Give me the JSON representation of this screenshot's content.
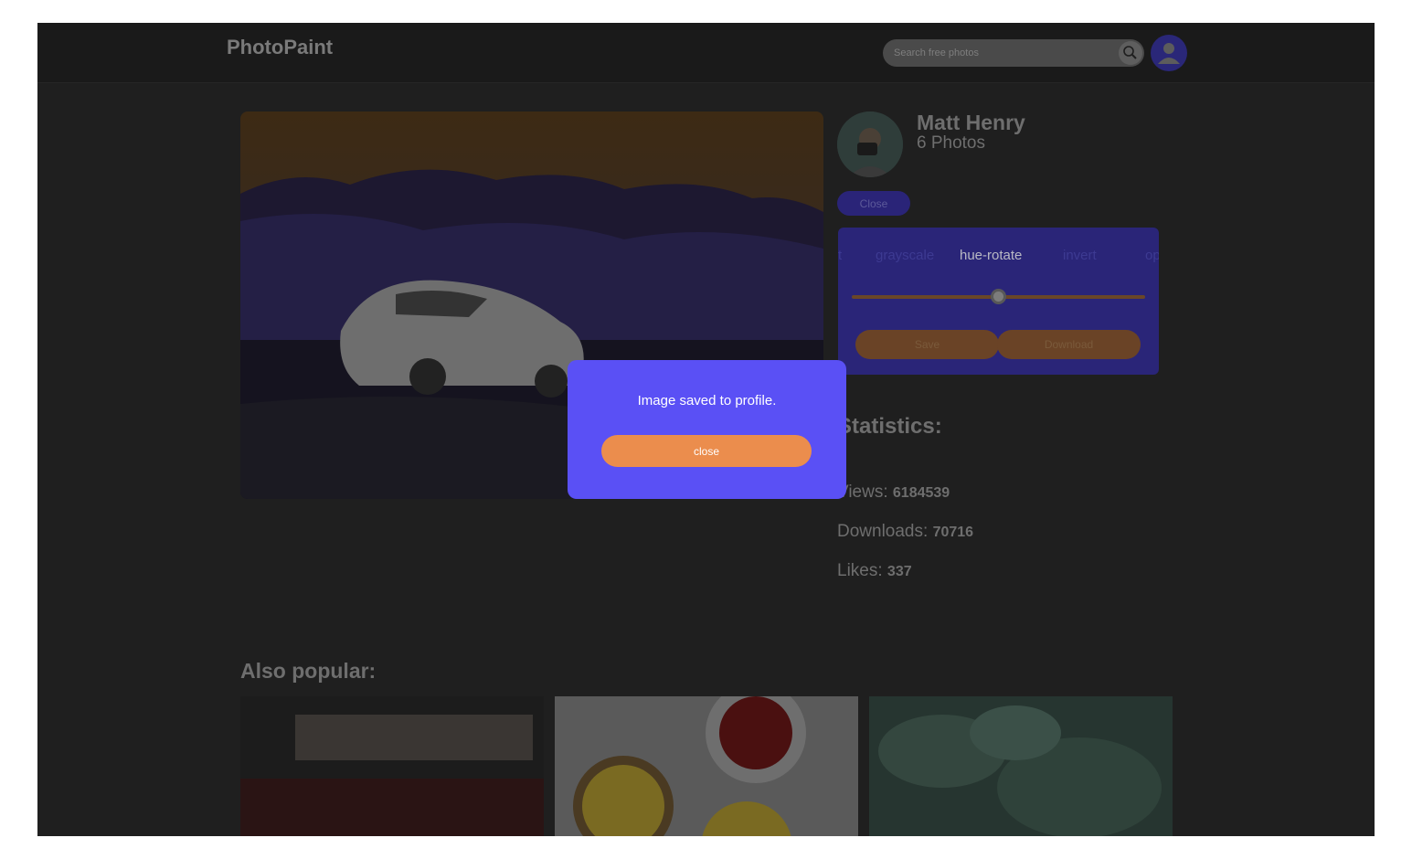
{
  "header": {
    "logo": "PhotoPaint",
    "search_placeholder": "Search free photos",
    "search_icon": "search-icon",
    "profile_icon": "user-icon"
  },
  "author": {
    "name": "Matt Henry",
    "photos": "6 Photos",
    "close_label": "Close"
  },
  "editor": {
    "filters": [
      "t",
      "grayscale",
      "hue-rotate",
      "invert",
      "op"
    ],
    "active_filter": "hue-rotate",
    "slider_value": 0.5,
    "save_label": "Save",
    "download_label": "Download"
  },
  "statistics": {
    "title": "Statistics:",
    "views_label": "Views:",
    "views": "6184539",
    "downloads_label": "Downloads:",
    "downloads": "70716",
    "likes_label": "Likes:",
    "likes": "337"
  },
  "popular": {
    "title": "Also popular:"
  },
  "modal": {
    "message": "Image saved to profile.",
    "close_label": "close"
  },
  "colors": {
    "modal_bg": "#5a50f5",
    "accent_orange": "#eb8d4d",
    "editor_bg": "#2a2578"
  }
}
